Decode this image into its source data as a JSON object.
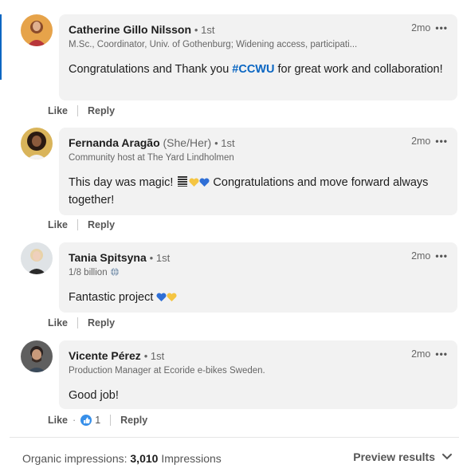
{
  "comments": [
    {
      "name": "Catherine Gillo Nilsson",
      "pronouns": "",
      "degree": "• 1st",
      "headline": "M.Sc., Coordinator, Univ. of Gothenburg; Widening access, participati...",
      "time": "2mo",
      "more": "•••",
      "text_parts": {
        "before": "Congratulations and Thank you ",
        "hashtag": "#CCWU",
        "after": " for great work and collaboration!"
      },
      "like": "Like",
      "reply": "Reply"
    },
    {
      "name": "Fernanda Aragão",
      "pronouns": "(She/Her)",
      "degree": "• 1st",
      "headline": "Community host at The Yard Lindholmen",
      "time": "2mo",
      "more": "•••",
      "text_parts": {
        "before": "This day was magic!",
        "after": "Congratulations and move forward always together!"
      },
      "like": "Like",
      "reply": "Reply"
    },
    {
      "name": "Tania Spitsyna",
      "pronouns": "",
      "degree": "• 1st",
      "headline": "1/8 billion",
      "time": "2mo",
      "more": "•••",
      "text_parts": {
        "before": "Fantastic project"
      },
      "like": "Like",
      "reply": "Reply"
    },
    {
      "name": "Vicente Pérez",
      "pronouns": "",
      "degree": "• 1st",
      "headline": "Production Manager at Ecoride e-bikes Sweden.",
      "time": "2mo",
      "more": "•••",
      "text_parts": {
        "before": "Good job!"
      },
      "like": "Like",
      "reactions": "1",
      "reply": "Reply"
    }
  ],
  "footer": {
    "impressions_label": "Organic impressions:",
    "impressions_value": "3,010",
    "impressions_unit": "Impressions",
    "preview_label": "Preview results"
  },
  "colors": {
    "link": "#0a66c2",
    "bubble": "#f2f2f2",
    "heart_blue": "#2f6fd6",
    "heart_yellow": "#f5c542"
  }
}
